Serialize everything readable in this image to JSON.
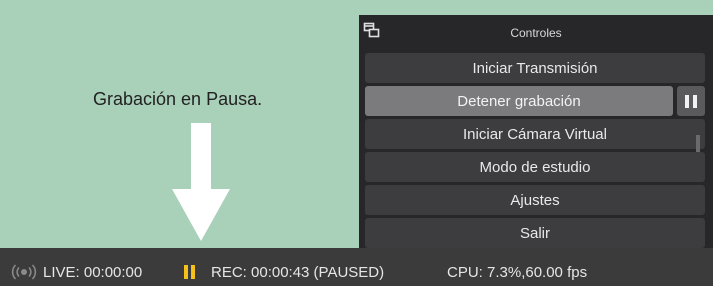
{
  "annotation": {
    "text": "Grabación en Pausa."
  },
  "controls": {
    "title": "Controles",
    "buttons": [
      "Iniciar Transmisión",
      "Detener grabación",
      "Iniciar Cámara Virtual",
      "Modo de estudio",
      "Ajustes",
      "Salir"
    ]
  },
  "statusbar": {
    "live": "LIVE: 00:00:00",
    "rec": "REC: 00:00:43 (PAUSED)",
    "cpu": "CPU: 7.3%,60.00 fps"
  },
  "icons": {
    "dock": "undock-icon",
    "pause": "pause-icon",
    "live": "broadcast-icon",
    "arrow": "arrow-down-icon"
  },
  "colors": {
    "background": "#a9d0b8",
    "panel": "#27272a",
    "button": "#3d3d3f",
    "button_active": "#7b7b7d",
    "statusbar": "#3b3b3b",
    "rec_paused": "#f5bf1c"
  }
}
